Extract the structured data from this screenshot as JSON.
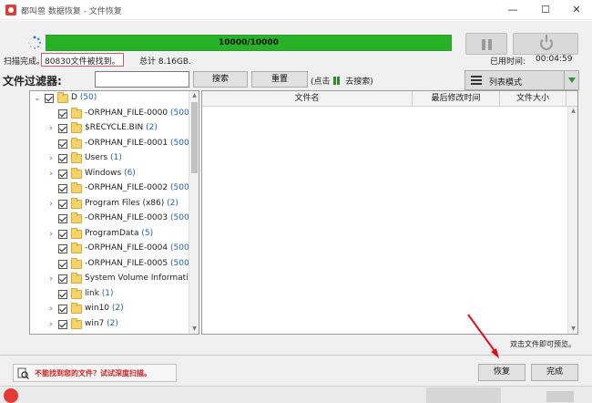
{
  "window": {
    "title": "都叫兽 数据恢复 - 文件恢复",
    "minimize": "—",
    "maximize": "☐",
    "close": "✕"
  },
  "scan": {
    "progress_label": "10000/10000",
    "progress_fraction": 1.0,
    "progress_color": "#27b127",
    "status": "扫描完成。",
    "found": "80830文件被找到。",
    "total": "总计 8.16GB.",
    "elapsed_label": "已用时间:",
    "elapsed_value": "00:04:59"
  },
  "filter": {
    "label": "文件过滤器:",
    "input_value": "",
    "search_button": "搜索",
    "reset_button": "重置",
    "hint_prefix": "(点击",
    "hint_suffix": "去搜索)",
    "view_mode": "列表模式"
  },
  "tree": {
    "items": [
      {
        "label": "D",
        "count": "(50)",
        "level": 0,
        "expandable": true,
        "expanded": true
      },
      {
        "label": "-ORPHAN_FILE-0000",
        "count": "(500)",
        "level": 1,
        "expandable": false
      },
      {
        "label": "$RECYCLE.BIN",
        "count": "(2)",
        "level": 1,
        "expandable": true
      },
      {
        "label": "-ORPHAN_FILE-0001",
        "count": "(500)",
        "level": 1,
        "expandable": false
      },
      {
        "label": "Users",
        "count": "(1)",
        "level": 1,
        "expandable": true
      },
      {
        "label": "Windows",
        "count": "(6)",
        "level": 1,
        "expandable": true
      },
      {
        "label": "-ORPHAN_FILE-0002",
        "count": "(500)",
        "level": 1,
        "expandable": false
      },
      {
        "label": "Program Files (x86)",
        "count": "(2)",
        "level": 1,
        "expandable": true
      },
      {
        "label": "-ORPHAN_FILE-0003",
        "count": "(500)",
        "level": 1,
        "expandable": false
      },
      {
        "label": "ProgramData",
        "count": "(5)",
        "level": 1,
        "expandable": true
      },
      {
        "label": "-ORPHAN_FILE-0004",
        "count": "(500)",
        "level": 1,
        "expandable": false
      },
      {
        "label": "-ORPHAN_FILE-0005",
        "count": "(500)",
        "level": 1,
        "expandable": false
      },
      {
        "label": "System Volume Information",
        "count": "",
        "level": 1,
        "expandable": true
      },
      {
        "label": "link",
        "count": "(1)",
        "level": 1,
        "expandable": false
      },
      {
        "label": "win10",
        "count": "(2)",
        "level": 1,
        "expandable": true
      },
      {
        "label": "win7",
        "count": "(2)",
        "level": 1,
        "expandable": true
      }
    ]
  },
  "files": {
    "columns": [
      "文件名",
      "最后修改时间",
      "文件大小"
    ],
    "rows": [],
    "preview_hint": "双击文件即可预览。"
  },
  "footer": {
    "deep_scan": "不能找到您的文件？试试深度扫描。",
    "recover_button": "恢复",
    "finish_button": "完成"
  },
  "colors": {
    "accent_green": "#27b127",
    "link_blue": "#1f5fbf",
    "warning_red": "#d32020"
  }
}
